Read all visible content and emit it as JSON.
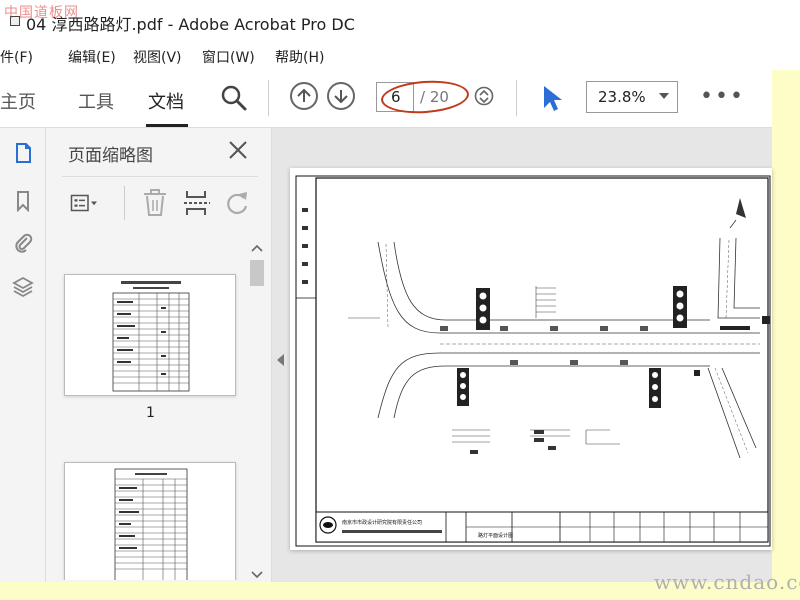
{
  "watermarks": {
    "top": "中国道板网",
    "bottom": "www.cndao.com"
  },
  "window": {
    "title": "04 淳西路路灯.pdf - Adobe Acrobat Pro DC"
  },
  "menu": [
    "文件(F)",
    "编辑(E)",
    "视图(V)",
    "窗口(W)",
    "帮助(H)"
  ],
  "toolbar": {
    "tabs": [
      "主页",
      "工具",
      "文档"
    ],
    "active_tab": "文档",
    "page_current": "6",
    "page_total": "/ 20",
    "zoom": "23.8%",
    "more": "•••"
  },
  "panel": {
    "title": "页面缩略图",
    "thumbnails": [
      {
        "label": "1"
      }
    ]
  },
  "document": {
    "drawing_title_block": "南京市市政设计研究院有限责任公司",
    "drawing_name": "路灯平面设计图"
  },
  "colors": {
    "accent": "#2b6fd6",
    "highlight_circle": "#c23a1c",
    "watermark_red": "#dd3333"
  }
}
